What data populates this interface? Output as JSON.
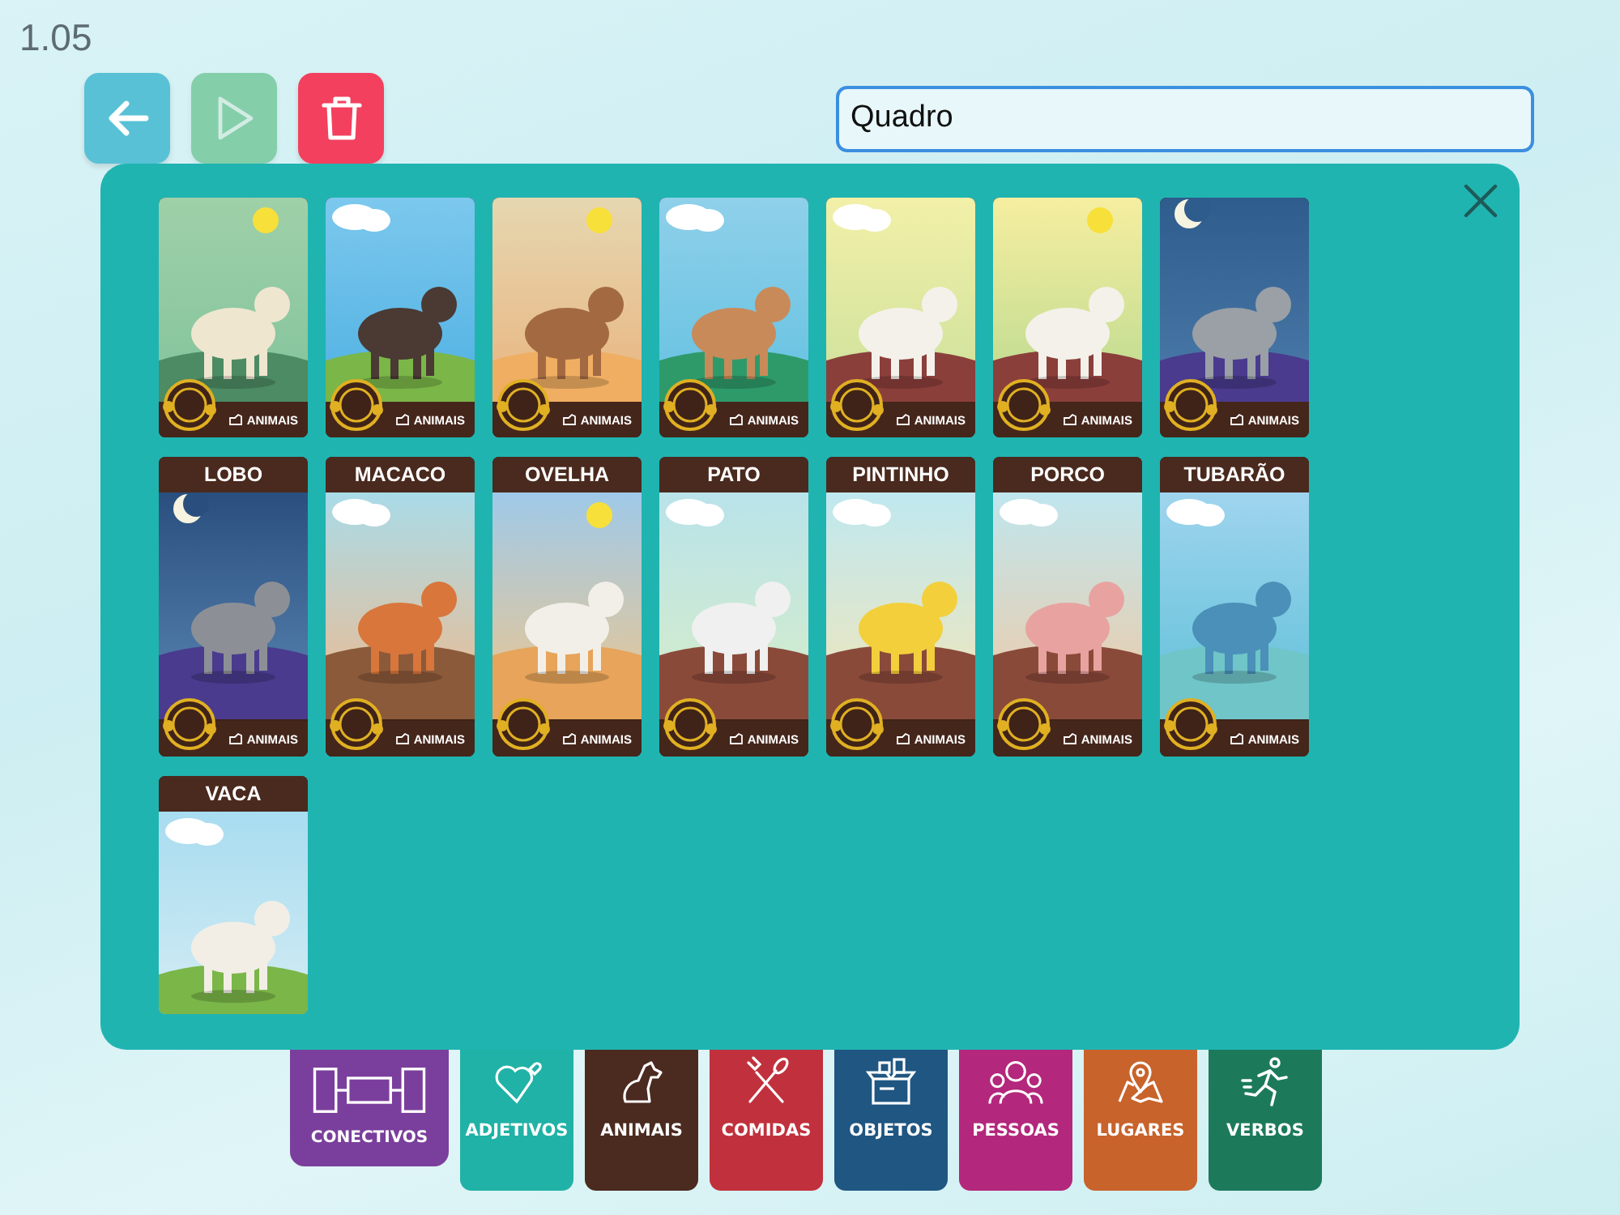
{
  "version": "1.05",
  "toolbar": {
    "back_disabled": false,
    "play_disabled": true,
    "delete_disabled": false
  },
  "search": {
    "value": "Quadro"
  },
  "cards": [
    {
      "footer": "ANIMAIS"
    },
    {
      "footer": "ANIMAIS"
    },
    {
      "footer": "ANIMAIS"
    },
    {
      "footer": "ANIMAIS"
    },
    {
      "footer": "ANIMAIS"
    },
    {
      "footer": "ANIMAIS"
    },
    {
      "footer": "ANIMAIS"
    },
    {
      "title": "LOBO",
      "footer": "ANIMAIS"
    },
    {
      "title": "MACACO",
      "footer": "ANIMAIS"
    },
    {
      "title": "OVELHA",
      "footer": "ANIMAIS"
    },
    {
      "title": "PATO",
      "footer": "ANIMAIS"
    },
    {
      "title": "PINTINHO",
      "footer": "ANIMAIS"
    },
    {
      "title": "PORCO",
      "footer": "ANIMAIS"
    },
    {
      "title": "TUBARÃO",
      "footer": "ANIMAIS"
    },
    {
      "title": "VACA"
    }
  ],
  "categories": [
    {
      "label": "CONECTIVOS",
      "kind": "connectors",
      "color": "#7a3f9c",
      "selected": true
    },
    {
      "label": "ADJETIVOS",
      "kind": "heart",
      "color": "#20b2a6",
      "selected": false
    },
    {
      "label": "ANIMAIS",
      "kind": "dog",
      "color": "#4b2a1f",
      "selected": false
    },
    {
      "label": "COMIDAS",
      "kind": "cutlery",
      "color": "#c1313d",
      "selected": false
    },
    {
      "label": "OBJETOS",
      "kind": "box",
      "color": "#1f5682",
      "selected": false
    },
    {
      "label": "PESSOAS",
      "kind": "people",
      "color": "#b3277c",
      "selected": false
    },
    {
      "label": "LUGARES",
      "kind": "map",
      "color": "#c8632b",
      "selected": false
    },
    {
      "label": "VERBOS",
      "kind": "runner",
      "color": "#1c7a5b",
      "selected": false
    }
  ]
}
